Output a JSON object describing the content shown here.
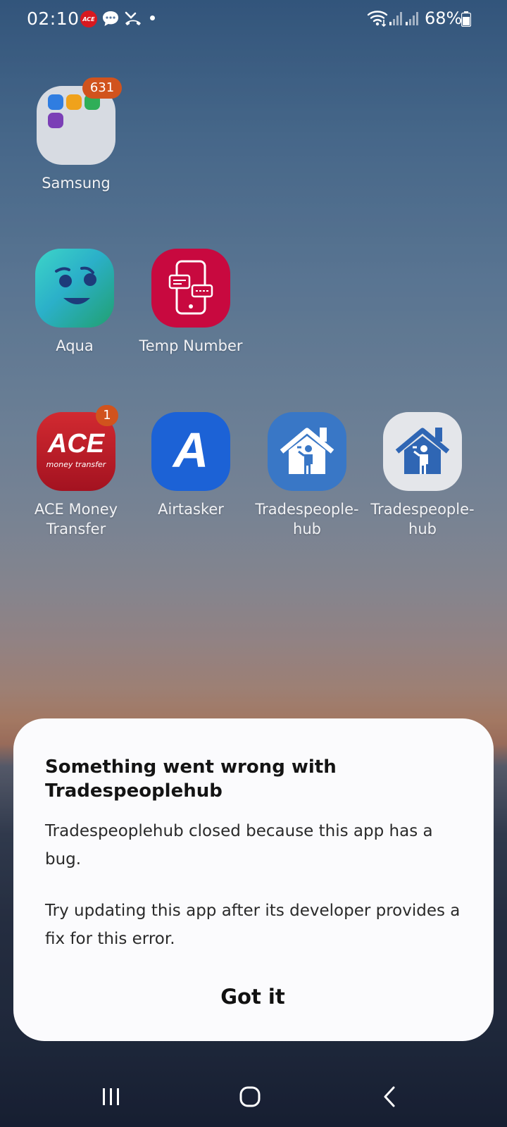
{
  "status_bar": {
    "time": "02:10",
    "ace_badge": "ACE",
    "battery_percent": "68%",
    "icons": [
      "ace-notification-icon",
      "chat-bubble-icon",
      "missed-call-icon",
      "dot-icon",
      "wifi-icon",
      "signal-icon",
      "signal-icon",
      "battery-icon"
    ]
  },
  "home": {
    "folder": {
      "label": "Samsung",
      "badge": "631"
    },
    "apps_row2": [
      {
        "label": "Aqua"
      },
      {
        "label": "Temp Number"
      }
    ],
    "apps_row3": [
      {
        "label": "ACE Money Transfer",
        "badge": "1",
        "icon_text": "ACE",
        "icon_subtext": "money transfer"
      },
      {
        "label": "Airtasker",
        "icon_text": "A"
      },
      {
        "label": "Tradespeople-hub"
      },
      {
        "label": "Tradespeople-hub"
      }
    ]
  },
  "dialog": {
    "title": "Something went wrong with Tradespeoplehub",
    "message_1": "Tradespeoplehub closed because this app has a bug.",
    "message_2": "Try updating this app after its developer provides a fix for this error.",
    "button_label": "Got it"
  },
  "nav_bar": {
    "items": [
      "recent-apps-icon",
      "home-icon",
      "back-icon"
    ]
  },
  "colors": {
    "dialog_bg": "#fbfbfd",
    "badge": "#d1531d",
    "ace_red": "#c8202b",
    "airtasker_blue": "#1c62d6",
    "temp_number_red": "#c8093f"
  }
}
